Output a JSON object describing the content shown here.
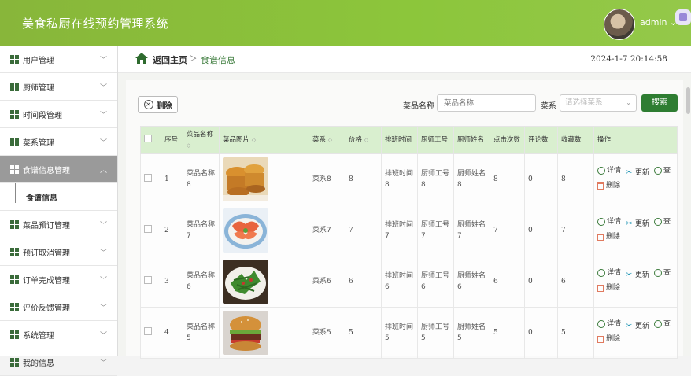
{
  "app": {
    "title": "美食私厨在线预约管理系统",
    "user": "admin",
    "user_chevron": "⌄"
  },
  "sidebar": {
    "items": [
      {
        "label": "用户管理",
        "active": false
      },
      {
        "label": "厨师管理",
        "active": false
      },
      {
        "label": "时间段管理",
        "active": false
      },
      {
        "label": "菜系管理",
        "active": false
      },
      {
        "label": "食谱信息管理",
        "active": true
      },
      {
        "label": "菜品预订管理",
        "active": false
      },
      {
        "label": "预订取消管理",
        "active": false
      },
      {
        "label": "订单完成管理",
        "active": false
      },
      {
        "label": "评价反馈管理",
        "active": false
      },
      {
        "label": "系统管理",
        "active": false
      },
      {
        "label": "我的信息",
        "active": false
      }
    ],
    "sub_item": "食谱信息"
  },
  "breadcrumb": {
    "home": "返回主页",
    "separator": "▷",
    "current": "食谱信息"
  },
  "datetime": "2024-1-7 20:14:58",
  "toolbar": {
    "delete_label": "删除",
    "name_label": "菜品名称",
    "name_placeholder": "菜品名称",
    "category_label": "菜系",
    "category_placeholder": "请选择菜系",
    "search_label": "搜索"
  },
  "table": {
    "headers": [
      "序号",
      "菜品名称",
      "菜品图片",
      "菜系",
      "价格",
      "排班时间",
      "厨师工号",
      "厨师姓名",
      "点击次数",
      "评论数",
      "收藏数",
      "操作"
    ],
    "ops": {
      "detail": "详情",
      "update": "更新",
      "view": "查",
      "delete": "删除"
    },
    "rows": [
      {
        "index": "1",
        "name": "菜品名称8",
        "image": "bread-cakes",
        "category": "菜系8",
        "price": "8",
        "schedule": "排班时间8",
        "chef_no": "厨师工号8",
        "chef_name": "厨师姓名8",
        "clicks": "8",
        "comments": "0",
        "favorites": "8"
      },
      {
        "index": "2",
        "name": "菜品名称7",
        "image": "shrimp-plate",
        "category": "菜系7",
        "price": "7",
        "schedule": "排班时间7",
        "chef_no": "厨师工号7",
        "chef_name": "厨师姓名7",
        "clicks": "7",
        "comments": "0",
        "favorites": "7"
      },
      {
        "index": "3",
        "name": "菜品名称6",
        "image": "green-vegetable-stirfry",
        "category": "菜系6",
        "price": "6",
        "schedule": "排班时间6",
        "chef_no": "厨师工号6",
        "chef_name": "厨师姓名6",
        "clicks": "6",
        "comments": "0",
        "favorites": "6"
      },
      {
        "index": "4",
        "name": "菜品名称5",
        "image": "burger",
        "category": "菜系5",
        "price": "5",
        "schedule": "排班时间5",
        "chef_no": "厨师工号5",
        "chef_name": "厨师姓名5",
        "clicks": "5",
        "comments": "0",
        "favorites": "5"
      }
    ]
  },
  "colors": {
    "header_green": "#8cc63b",
    "accent": "#2e7d32",
    "table_head": "#d9efcf"
  }
}
